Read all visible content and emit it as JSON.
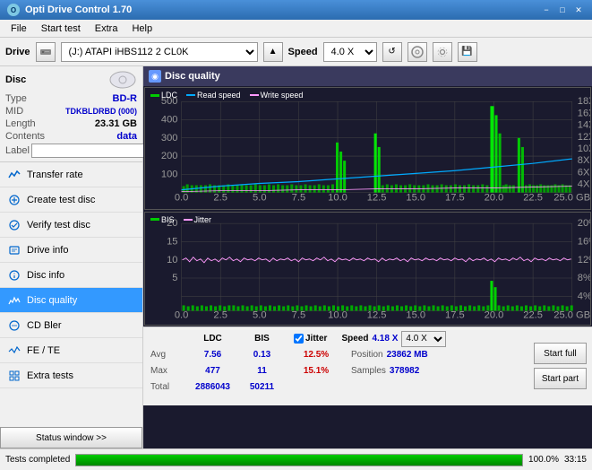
{
  "titleBar": {
    "title": "Opti Drive Control 1.70",
    "minBtn": "−",
    "maxBtn": "□",
    "closeBtn": "✕"
  },
  "menuBar": {
    "items": [
      "File",
      "Start test",
      "Extra",
      "Help"
    ]
  },
  "driveBar": {
    "label": "Drive",
    "driveValue": "(J:)  ATAPI iHBS112  2 CL0K",
    "speedLabel": "Speed",
    "speedValue": "4.0 X"
  },
  "sidebar": {
    "disc": {
      "title": "Disc",
      "typeLabel": "Type",
      "typeValue": "BD-R",
      "midLabel": "MID",
      "midValue": "TDKBLDRBD (000)",
      "lengthLabel": "Length",
      "lengthValue": "23.31 GB",
      "contentsLabel": "Contents",
      "contentsValue": "data",
      "labelLabel": "Label",
      "labelValue": ""
    },
    "navItems": [
      {
        "id": "transfer-rate",
        "label": "Transfer rate",
        "active": false
      },
      {
        "id": "create-test-disc",
        "label": "Create test disc",
        "active": false
      },
      {
        "id": "verify-test-disc",
        "label": "Verify test disc",
        "active": false
      },
      {
        "id": "drive-info",
        "label": "Drive info",
        "active": false
      },
      {
        "id": "disc-info",
        "label": "Disc info",
        "active": false
      },
      {
        "id": "disc-quality",
        "label": "Disc quality",
        "active": true
      },
      {
        "id": "cd-bler",
        "label": "CD Bler",
        "active": false
      },
      {
        "id": "fe-te",
        "label": "FE / TE",
        "active": false
      },
      {
        "id": "extra-tests",
        "label": "Extra tests",
        "active": false
      }
    ],
    "statusWindowBtn": "Status window >>"
  },
  "discQuality": {
    "title": "Disc quality",
    "legend": {
      "ldc": "LDC",
      "readSpeed": "Read speed",
      "writeSpeed": "Write speed",
      "bis": "BIS",
      "jitter": "Jitter"
    }
  },
  "stats": {
    "columns": [
      "LDC",
      "BIS"
    ],
    "rows": [
      {
        "label": "Avg",
        "ldc": "7.56",
        "bis": "0.13"
      },
      {
        "label": "Max",
        "ldc": "477",
        "bis": "11"
      },
      {
        "label": "Total",
        "ldc": "2886043",
        "bis": "50211"
      }
    ],
    "jitter": {
      "checked": true,
      "label": "Jitter",
      "avgVal": "12.5%",
      "maxVal": "15.1%",
      "totalVal": ""
    },
    "speed": {
      "label": "Speed",
      "value": "4.18 X",
      "selectValue": "4.0 X"
    },
    "position": {
      "label": "Position",
      "value": "23862 MB"
    },
    "samples": {
      "label": "Samples",
      "value": "378982"
    },
    "startFullBtn": "Start full",
    "startPartBtn": "Start part"
  },
  "statusBar": {
    "text": "Tests completed",
    "progress": "100.0%",
    "progressValue": 100,
    "time": "33:15"
  }
}
